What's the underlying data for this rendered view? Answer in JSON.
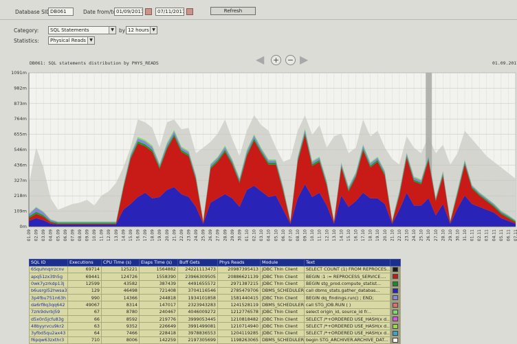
{
  "filters": {
    "sid_label": "Database SID:",
    "sid_value": "DB061",
    "date_label": "Date from/to:",
    "date_from": "01/09/2017",
    "date_to": "07/11/2017",
    "refresh_label": "Refresh",
    "category_label": "Category:",
    "category_value": "SQL Statements",
    "by_label": "by",
    "by_value": "12 hours",
    "statistics_label": "Statistics:",
    "statistics_value": "Physical Reads"
  },
  "chart_header": {
    "title": "DB061: SQL statements distribution by PHYS_READS",
    "date": "01.09.2017"
  },
  "chart_data": {
    "type": "area",
    "yaxis_ticks": [
      "1091m",
      "982m",
      "873m",
      "764m",
      "655m",
      "546m",
      "436m",
      "327m",
      "218m",
      "109m",
      "0m"
    ],
    "ylim": [
      0,
      1091
    ],
    "ylabel_unit": "m",
    "x_dates": [
      "01.09",
      "02.09",
      "03.09",
      "04.09",
      "05.09",
      "06.09",
      "07.09",
      "08.09",
      "09.09",
      "10.09",
      "11.09",
      "12.09",
      "13.09",
      "14.09",
      "15.09",
      "16.09",
      "17.09",
      "18.09",
      "19.09",
      "20.09",
      "21.09",
      "22.09",
      "23.09",
      "24.09",
      "25.09",
      "26.09",
      "27.09",
      "28.09",
      "29.09",
      "30.09",
      "01.10",
      "02.10",
      "03.10",
      "04.10",
      "05.10",
      "06.10",
      "07.10",
      "08.10",
      "09.10",
      "10.10",
      "11.10",
      "12.10",
      "13.10",
      "14.10",
      "15.10",
      "16.10",
      "17.10",
      "18.10",
      "19.10",
      "20.10",
      "21.10",
      "22.10",
      "23.10",
      "24.10",
      "25.10",
      "26.10",
      "27.10",
      "28.10",
      "29.10",
      "30.10",
      "31.10",
      "01.11",
      "02.11",
      "03.11",
      "04.11",
      "05.11",
      "06.11",
      "07.11"
    ],
    "series": [
      {
        "color": "#2a23b8",
        "values": [
          40,
          60,
          45,
          20,
          15,
          15,
          15,
          15,
          15,
          15,
          15,
          15,
          15,
          120,
          160,
          210,
          240,
          200,
          210,
          260,
          280,
          230,
          210,
          140,
          20,
          170,
          200,
          230,
          200,
          140,
          260,
          290,
          250,
          210,
          220,
          120,
          20,
          200,
          300,
          210,
          240,
          150,
          20,
          220,
          140,
          180,
          240,
          200,
          200,
          160,
          20,
          120,
          240,
          150,
          150,
          200,
          80,
          160,
          20,
          130,
          220,
          160,
          140,
          120,
          100,
          60,
          40,
          20
        ]
      },
      {
        "color": "#c81a16",
        "values": [
          20,
          30,
          25,
          10,
          5,
          5,
          5,
          5,
          5,
          5,
          5,
          5,
          5,
          150,
          320,
          380,
          330,
          330,
          200,
          290,
          360,
          300,
          290,
          190,
          10,
          240,
          260,
          300,
          240,
          170,
          240,
          320,
          270,
          230,
          220,
          130,
          10,
          260,
          350,
          220,
          220,
          140,
          10,
          200,
          110,
          170,
          300,
          220,
          260,
          200,
          10,
          100,
          250,
          170,
          150,
          270,
          100,
          200,
          10,
          100,
          220,
          110,
          80,
          60,
          40,
          30,
          20,
          10
        ]
      },
      {
        "color": "#1f9a2a",
        "values": [
          12,
          15,
          12,
          8,
          8,
          8,
          8,
          8,
          8,
          8,
          8,
          8,
          8,
          10,
          12,
          15,
          14,
          14,
          12,
          14,
          15,
          14,
          13,
          12,
          8,
          12,
          13,
          14,
          13,
          12,
          14,
          15,
          14,
          13,
          13,
          12,
          8,
          13,
          15,
          13,
          13,
          12,
          8,
          13,
          12,
          12,
          14,
          13,
          13,
          12,
          8,
          12,
          13,
          12,
          12,
          13,
          10,
          12,
          8,
          10,
          12,
          10,
          10,
          10,
          10,
          10,
          10,
          8
        ]
      },
      {
        "color": "#8b86d9",
        "values": [
          15,
          30,
          20,
          10,
          5,
          5,
          5,
          5,
          5,
          5,
          5,
          5,
          5,
          10,
          15,
          20,
          20,
          20,
          15,
          20,
          20,
          15,
          15,
          15,
          5,
          15,
          15,
          20,
          15,
          15,
          20,
          20,
          15,
          15,
          15,
          15,
          5,
          15,
          20,
          15,
          15,
          15,
          5,
          15,
          15,
          15,
          20,
          15,
          15,
          15,
          5,
          15,
          15,
          15,
          15,
          15,
          10,
          15,
          5,
          15,
          15,
          10,
          10,
          10,
          10,
          8,
          8,
          5
        ]
      },
      {
        "color": "#7fd872",
        "values": [
          5,
          5,
          5,
          3,
          3,
          3,
          3,
          3,
          3,
          3,
          3,
          3,
          3,
          5,
          8,
          10,
          10,
          10,
          8,
          10,
          10,
          8,
          8,
          8,
          3,
          8,
          8,
          10,
          8,
          8,
          10,
          10,
          8,
          8,
          8,
          8,
          3,
          8,
          10,
          8,
          8,
          8,
          3,
          8,
          8,
          8,
          10,
          8,
          8,
          8,
          3,
          8,
          8,
          8,
          8,
          8,
          5,
          8,
          3,
          8,
          8,
          5,
          5,
          5,
          5,
          5,
          5,
          3
        ]
      }
    ],
    "background_total": [
      300,
      560,
      420,
      200,
      120,
      140,
      160,
      170,
      190,
      150,
      220,
      250,
      310,
      420,
      560,
      760,
      740,
      700,
      560,
      740,
      760,
      690,
      700,
      520,
      560,
      600,
      660,
      760,
      620,
      500,
      680,
      790,
      720,
      680,
      560,
      460,
      480,
      680,
      790,
      650,
      720,
      560,
      640,
      660,
      520,
      560,
      760,
      640,
      680,
      560,
      480,
      440,
      640,
      560,
      520,
      640,
      520,
      580,
      440,
      520,
      680,
      620,
      560,
      500,
      460,
      420,
      380,
      340
    ],
    "highlight_x": "26.10"
  },
  "table": {
    "headers": [
      "SQL ID",
      "Executions",
      "CPU Time (s)",
      "Elaps Time (s)",
      "Buff Gets",
      "Phys Reads",
      "Module",
      "Text",
      ""
    ],
    "rows": [
      {
        "sql_id": "6Squhnqrrzcnv",
        "executions": "69714",
        "cpu": "125221",
        "elaps": "1564882",
        "buff": "24221113473",
        "phys": "20987395413",
        "module": "JDBC Thin Client",
        "text": "SELECT COUNT (1) FROM REPROCES...",
        "color": "#1a1a1a"
      },
      {
        "sql_id": "apq51zx3th5g",
        "executions": "69441",
        "cpu": "124726",
        "elaps": "1558390",
        "buff": "23966309505",
        "phys": "20886621139",
        "module": "JDBC Thin Client",
        "text": "BEGIN :1 := REPROCESS_SERVICE....",
        "color": "#c41b14"
      },
      {
        "sql_id": "0wk7yzrkdp13j",
        "executions": "12599",
        "cpu": "43582",
        "elaps": "387439",
        "buff": "4491655572",
        "phys": "2971387215",
        "module": "JDBC Thin Client",
        "text": "BEGIN stg_prod.compute_statist...",
        "color": "#1a8a2a"
      },
      {
        "sql_id": "b6usrgl52hwsa3",
        "executions": "129",
        "cpu": "46498",
        "elaps": "721408",
        "buff": "3704116546",
        "phys": "2785479706",
        "module": "DBMS_SCHEDULER",
        "text": "call dbms_stats.gather_databas...",
        "color": "#2a23b8"
      },
      {
        "sql_id": "3p4fbu751n63h",
        "executions": "990",
        "cpu": "14366",
        "elaps": "244818",
        "buff": "1934101858",
        "phys": "1581440415",
        "module": "JDBC Thin Client",
        "text": "BEGIN dq_findings.run() ; END;",
        "color": "#8b86d9"
      },
      {
        "sql_id": "da6rf8q3qq642",
        "executions": "49067",
        "cpu": "8314",
        "elaps": "147017",
        "buff": "2323943283",
        "phys": "1241528119",
        "module": "DBMS_SCHEDULER",
        "text": "call STG_JOB.RUN ( )",
        "color": "#e07070"
      },
      {
        "sql_id": "7zrk9dvrbj59",
        "executions": "67",
        "cpu": "8780",
        "elaps": "240467",
        "buff": "4046009272",
        "phys": "1212776578",
        "module": "JDBC Thin Client",
        "text": "select origin_id, source_id fr...",
        "color": "#7fd872"
      },
      {
        "sql_id": "d5x0n5jcfu83g",
        "executions": "66",
        "cpu": "8592",
        "elaps": "219776",
        "buff": "3999053445",
        "phys": "1210818482",
        "module": "JDBC Thin Client",
        "text": "SELECT /*+ORDERED USE_HASH(x d...",
        "color": "#d05ad8"
      },
      {
        "sql_id": "48byyrvcu9kr2",
        "executions": "63",
        "cpu": "9352",
        "elaps": "226649",
        "buff": "3991499081",
        "phys": "1210714940",
        "module": "JDBC Thin Client",
        "text": "SELECT /*+ORDERED USE_HASH(x d...",
        "color": "#9ad84a"
      },
      {
        "sql_id": "3yfbd5qu2ax43",
        "executions": "64",
        "cpu": "7466",
        "elaps": "228418",
        "buff": "3978836553",
        "phys": "1204119285",
        "module": "JDBC Thin Client",
        "text": "SELECT /*+ORDERED USE_HASH(x d...",
        "color": "#3aa8c8"
      },
      {
        "sql_id": "f6pqw63zxthr3",
        "executions": "710",
        "cpu": "8006",
        "elaps": "142259",
        "buff": "2197305699",
        "phys": "1198263065",
        "module": "DBMS_SCHEDULER",
        "text": "begin STG_ARCHIVER.ARCHIVE_DAT...",
        "color": "#ffffff"
      }
    ]
  }
}
